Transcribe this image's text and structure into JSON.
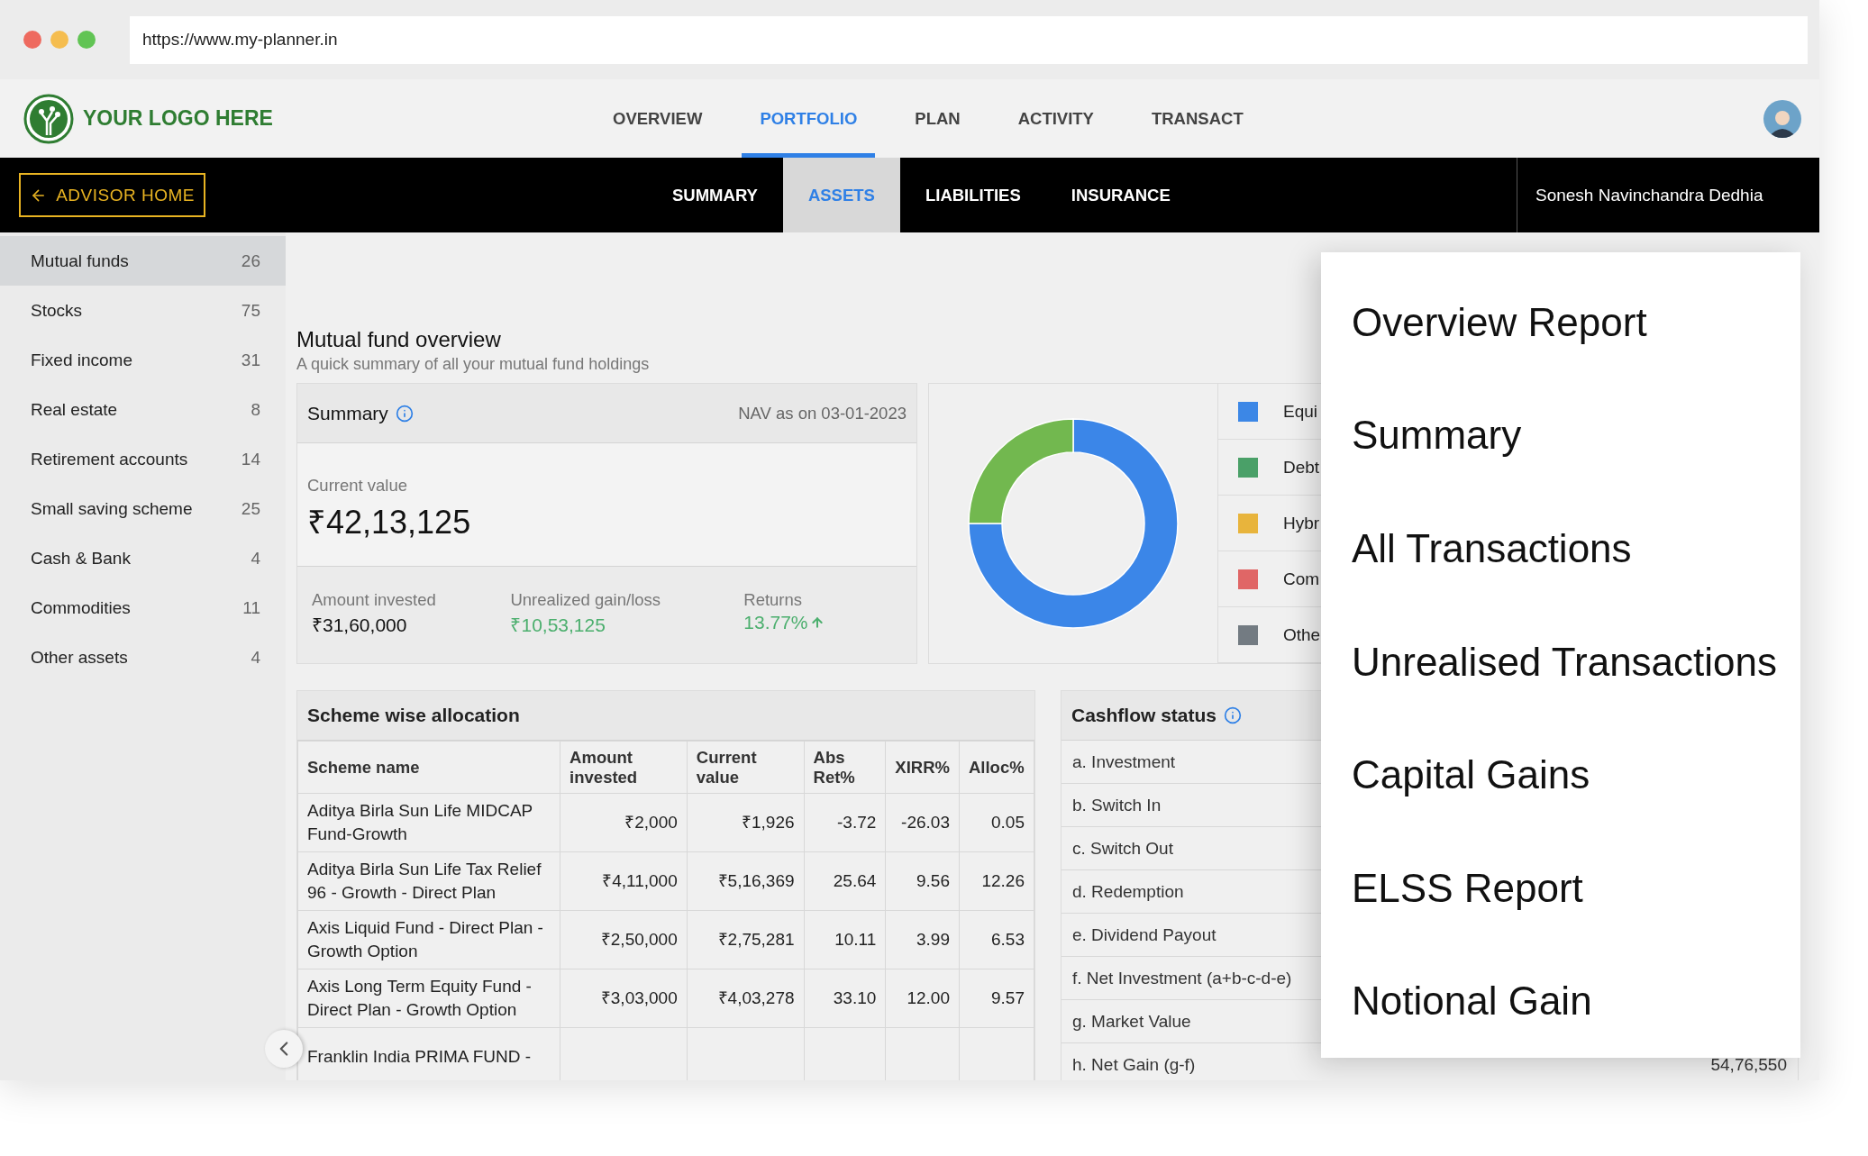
{
  "browser": {
    "url": "https://www.my-planner.in"
  },
  "header": {
    "logo_text": "YOUR LOGO HERE",
    "nav": [
      {
        "label": "OVERVIEW",
        "selected": false
      },
      {
        "label": "PORTFOLIO",
        "selected": true
      },
      {
        "label": "PLAN",
        "selected": false
      },
      {
        "label": "ACTIVITY",
        "selected": false
      },
      {
        "label": "TRANSACT",
        "selected": false
      }
    ]
  },
  "subnav": {
    "back_button": "ADVISOR HOME",
    "tabs": [
      {
        "label": "SUMMARY",
        "selected": false
      },
      {
        "label": "ASSETS",
        "selected": true
      },
      {
        "label": "LIABILITIES",
        "selected": false
      },
      {
        "label": "INSURANCE",
        "selected": false
      }
    ],
    "user_name": "Sonesh Navinchandra Dedhia"
  },
  "sidebar": {
    "items": [
      {
        "label": "Mutual funds",
        "count": "26",
        "selected": true
      },
      {
        "label": "Stocks",
        "count": "75",
        "selected": false
      },
      {
        "label": "Fixed income",
        "count": "31",
        "selected": false
      },
      {
        "label": "Real estate",
        "count": "8",
        "selected": false
      },
      {
        "label": "Retirement accounts",
        "count": "14",
        "selected": false
      },
      {
        "label": "Small saving scheme",
        "count": "25",
        "selected": false
      },
      {
        "label": "Cash & Bank",
        "count": "4",
        "selected": false
      },
      {
        "label": "Commodities",
        "count": "11",
        "selected": false
      },
      {
        "label": "Other assets",
        "count": "4",
        "selected": false
      }
    ]
  },
  "overview": {
    "title": "Mutual fund overview",
    "subtitle": "A quick summary of all your mutual fund holdings",
    "summary": {
      "title": "Summary",
      "nav_date": "NAV as on 03-01-2023",
      "current_value_label": "Current value",
      "current_value": "₹42,13,125",
      "stats": [
        {
          "label": "Amount invested",
          "value": "₹31,60,000",
          "kind": "plain"
        },
        {
          "label": "Unrealized gain/loss",
          "value": "₹10,53,125",
          "kind": "gain"
        },
        {
          "label": "Returns",
          "value": "13.77%",
          "kind": "gain_up"
        }
      ]
    },
    "allocation_legend": [
      {
        "label": "Equi",
        "color": "#3c87e6"
      },
      {
        "label": "Debt",
        "color": "#4aa068"
      },
      {
        "label": "Hybr",
        "color": "#e8b43c"
      },
      {
        "label": "Com",
        "color": "#e06666"
      },
      {
        "label": "Othe",
        "color": "#737b82"
      }
    ]
  },
  "scheme_table": {
    "title": "Scheme wise allocation",
    "columns": [
      "Scheme name",
      "Amount invested",
      "Current value",
      "Abs Ret%",
      "XIRR%",
      "Alloc%"
    ],
    "rows": [
      [
        "Aditya Birla Sun Life MIDCAP Fund-Growth",
        "₹2,000",
        "₹1,926",
        "-3.72",
        "-26.03",
        "0.05"
      ],
      [
        "Aditya Birla Sun Life Tax Relief 96 - Growth - Direct Plan",
        "₹4,11,000",
        "₹5,16,369",
        "25.64",
        "9.56",
        "12.26"
      ],
      [
        "Axis Liquid Fund - Direct Plan - Growth Option",
        "₹2,50,000",
        "₹2,75,281",
        "10.11",
        "3.99",
        "6.53"
      ],
      [
        "Axis Long Term Equity Fund - Direct Plan - Growth Option",
        "₹3,03,000",
        "₹4,03,278",
        "33.10",
        "12.00",
        "9.57"
      ],
      [
        "Franklin India PRIMA FUND -"
      ]
    ]
  },
  "cashflow": {
    "title": "Cashflow status",
    "rows": [
      {
        "label": "a. Investment"
      },
      {
        "label": "b. Switch In"
      },
      {
        "label": "c. Switch Out"
      },
      {
        "label": "d. Redemption"
      },
      {
        "label": "e. Dividend Payout"
      },
      {
        "label": "f. Net Investment (a+b-c-d-e)"
      },
      {
        "label": "g. Market Value"
      },
      {
        "label": "h. Net Gain (g-f)",
        "value": "54,76,550"
      }
    ]
  },
  "report_menu": {
    "items": [
      "Overview Report",
      "Summary",
      "All Transactions",
      "Unrealised Transactions",
      "Capital Gains",
      "ELSS Report",
      "Notional Gain"
    ]
  }
}
